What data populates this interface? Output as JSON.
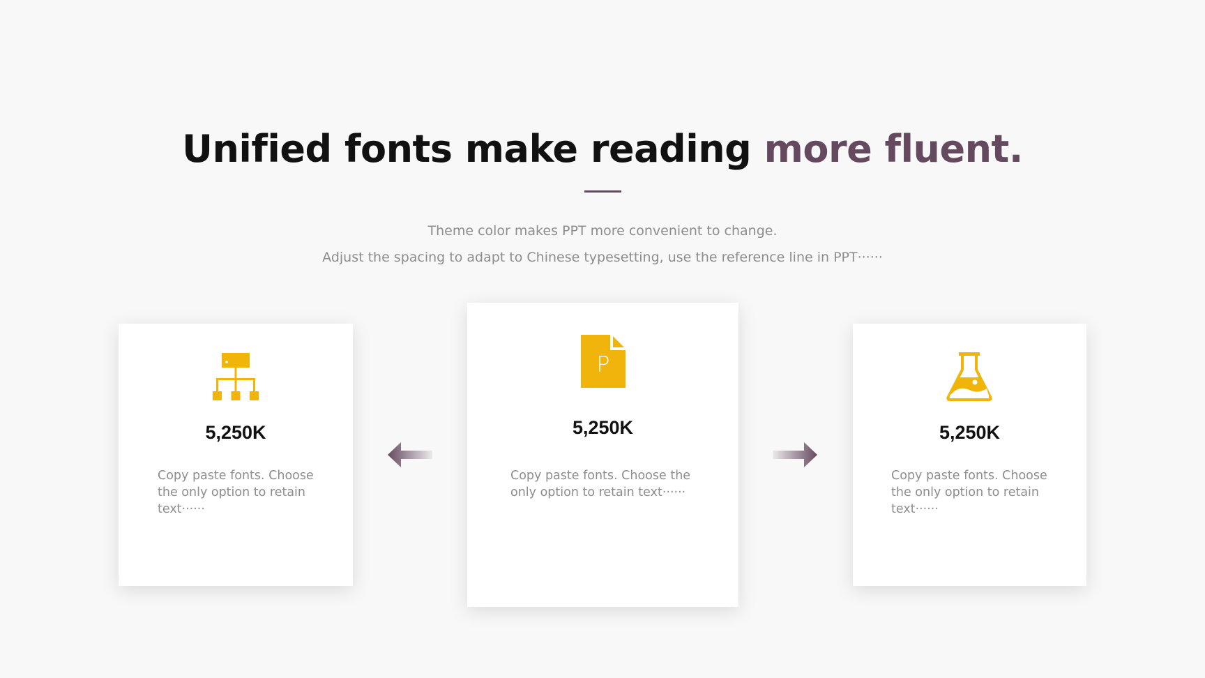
{
  "title": {
    "part1": "Unified fonts make reading ",
    "part2": "more fluent."
  },
  "subtitle": {
    "line1": "Theme color makes PPT more convenient to change.",
    "line2": "Adjust the spacing to adapt to Chinese typesetting, use the reference line in PPT······"
  },
  "colors": {
    "accent": "#654a5f",
    "icon": "#f0b40a",
    "background": "#f8f8f8",
    "heading": "#111111",
    "body_text": "#8d8d8d"
  },
  "cards": [
    {
      "icon": "org-chart-icon",
      "value": "5,250K",
      "text": "Copy paste fonts. Choose the only option to retain text······"
    },
    {
      "icon": "ppt-file-icon",
      "icon_letter": "P",
      "value": "5,250K",
      "text": "Copy paste fonts. Choose the only option to retain text······"
    },
    {
      "icon": "flask-icon",
      "value": "5,250K",
      "text": "Copy paste fonts. Choose the only option to retain text······"
    }
  ],
  "arrows": [
    {
      "icon": "arrow-left-icon",
      "direction": "left"
    },
    {
      "icon": "arrow-right-icon",
      "direction": "right"
    }
  ]
}
